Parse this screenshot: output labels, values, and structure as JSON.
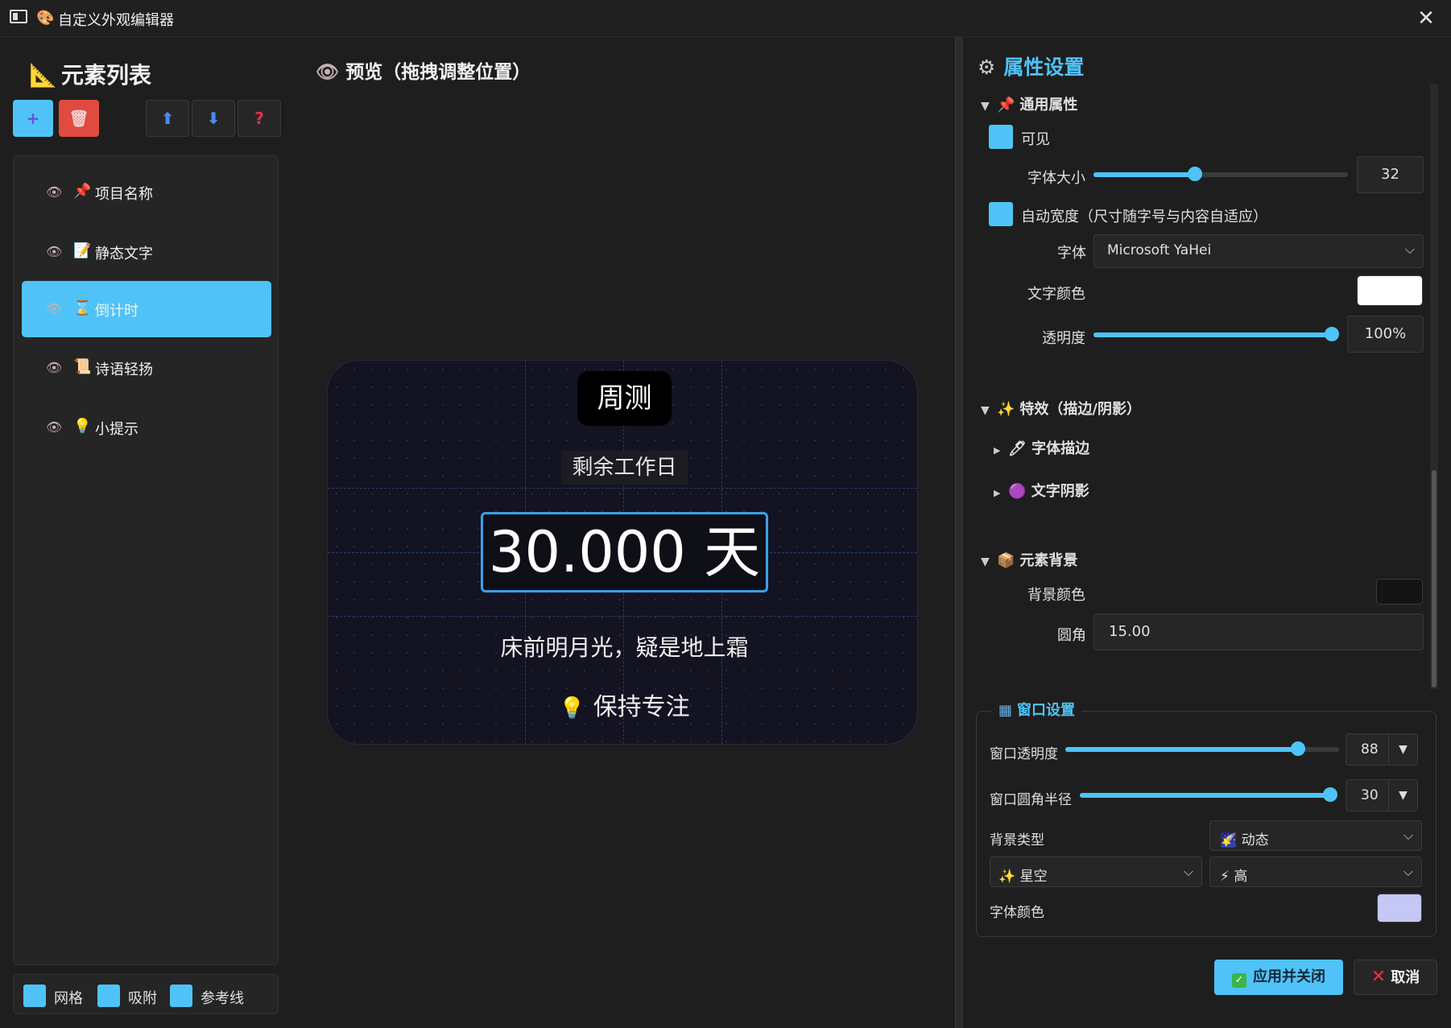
{
  "window": {
    "title": "自定义外观编辑器",
    "close_glyph": "✕",
    "icons": [
      "app-window-icon",
      "palette-icon"
    ]
  },
  "left_panel": {
    "heading": "元素列表",
    "toolbar": {
      "add_glyph": "+",
      "delete_glyph": "🗑",
      "up_glyph": "⬆",
      "down_glyph": "⬇",
      "help_glyph": "?"
    },
    "elements": [
      {
        "label": "项目名称",
        "emoji": "📌",
        "visible_icon": "eye-icon",
        "selected": false
      },
      {
        "label": "静态文字",
        "emoji": "📝",
        "visible_icon": "eye-icon",
        "selected": false
      },
      {
        "label": "倒计时",
        "emoji": "⌛",
        "visible_icon": "eye-icon",
        "selected": true
      },
      {
        "label": "诗语轻扬",
        "emoji": "📜",
        "visible_icon": "eye-icon",
        "selected": false
      },
      {
        "label": "小提示",
        "emoji": "💡",
        "visible_icon": "eye-icon",
        "selected": false
      }
    ],
    "toggles": [
      {
        "label": "网格",
        "checked": true
      },
      {
        "label": "吸附",
        "checked": true
      },
      {
        "label": "参考线",
        "checked": true
      }
    ]
  },
  "preview": {
    "heading": "预览（拖拽调整位置）",
    "project_name": "周测",
    "static_text": "剩余工作日",
    "countdown": "30.000 天",
    "poem": "床前明月光，疑是地上霜",
    "tip": "保持专注",
    "tip_emoji": "💡"
  },
  "properties": {
    "heading": "属性设置",
    "general": {
      "title": "通用属性",
      "emoji": "📌",
      "visible_label": "可见",
      "font_size_label": "字体大小",
      "font_size_value": "32",
      "font_size_fraction": 0.4,
      "auto_width_label": "自动宽度（尺寸随字号与内容自适应）",
      "font_label": "字体",
      "font_value": "Microsoft YaHei",
      "text_color_label": "文字颜色",
      "text_color": "#ffffff",
      "opacity_label": "透明度",
      "opacity_value": "100%",
      "opacity_fraction": 1.0
    },
    "effects": {
      "title": "特效（描边/阴影）",
      "emoji": "✨",
      "stroke_label": "字体描边",
      "stroke_emoji": "🖊",
      "shadow_label": "文字阴影",
      "shadow_emoji": "🟣"
    },
    "background": {
      "title": "元素背景",
      "emoji": "📦",
      "bg_color_label": "背景颜色",
      "bg_color": "#141414",
      "radius_label": "圆角",
      "radius_value": "15.00"
    }
  },
  "window_settings": {
    "title": "窗口设置",
    "opacity_label": "窗口透明度",
    "opacity_value": "88",
    "opacity_fraction": 0.85,
    "radius_label": "窗口圆角半径",
    "radius_value": "30",
    "radius_fraction": 1.0,
    "bg_type_label": "背景类型",
    "bg_type_value": "动态",
    "bg_type_emoji": "🌠",
    "effect_value": "星空",
    "effect_emoji": "✨",
    "quality_value": "高",
    "quality_emoji": "⚡",
    "font_color_label": "字体颜色",
    "font_color": "#c5c8f5"
  },
  "actions": {
    "apply_label": "应用并关闭",
    "cancel_label": "取消"
  },
  "colors": {
    "accent": "#4fc3f7",
    "danger": "#e04a3f",
    "canvas_bg": "#131322",
    "panel_bg": "#1e1e1e"
  }
}
